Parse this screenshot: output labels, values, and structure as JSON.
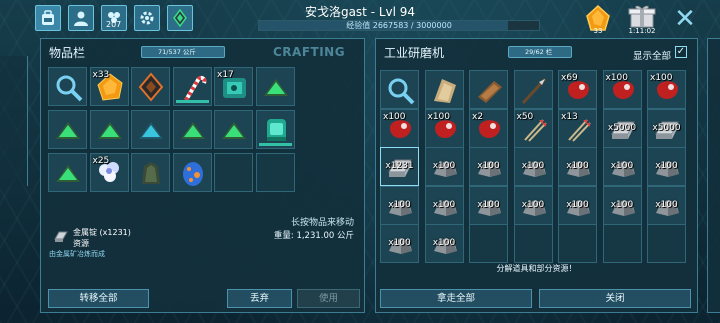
{
  "topbar": {
    "tabs": [
      {
        "icon": "backpack-icon",
        "count": ""
      },
      {
        "icon": "character-icon",
        "count": ""
      },
      {
        "icon": "engrams-icon",
        "count": "207"
      },
      {
        "icon": "tribe-settings-icon",
        "count": ""
      },
      {
        "icon": "element-crystal-icon",
        "count": ""
      }
    ],
    "title": "安戈洛gast - Lvl 94",
    "xp_text": "经验值 2667583 / 3000000",
    "xp_fraction": 0.889,
    "amber_count": "33",
    "gift_timer": "1:11:02",
    "close_glyph": "✕"
  },
  "inventory": {
    "title": "物品栏",
    "weight_pill": "71/537 公斤",
    "crafting_tab": "CRAFTING",
    "slots": [
      {
        "icon": "magnifier-icon",
        "qty": ""
      },
      {
        "icon": "amber-icon",
        "qty": "x33"
      },
      {
        "icon": "implant-icon",
        "qty": ""
      },
      {
        "icon": "candy-cane-icon",
        "qty": ""
      },
      {
        "icon": "cryo-chip-icon",
        "qty": "x17"
      },
      {
        "icon": "green-note-icon",
        "qty": ""
      },
      {
        "icon": "green-note-icon",
        "qty": ""
      },
      {
        "icon": "green-note-icon",
        "qty": ""
      },
      {
        "icon": "blue-note-icon",
        "qty": ""
      },
      {
        "icon": "green-note-icon",
        "qty": ""
      },
      {
        "icon": "green-note-icon",
        "qty": ""
      },
      {
        "icon": "cryo-pod-icon",
        "qty": ""
      },
      {
        "icon": "green-note-icon",
        "qty": ""
      },
      {
        "icon": "white-flower-icon",
        "qty": "x25"
      },
      {
        "icon": "ghillie-armor-icon",
        "qty": ""
      },
      {
        "icon": "blue-egg-icon",
        "qty": ""
      }
    ],
    "hint": "长按物品来移动",
    "weight_line": "重量: 1,231.00 公斤",
    "selected_item": {
      "name": "金属锭 (x1231)",
      "type": "资源",
      "desc": "由金属矿冶炼而成"
    },
    "buttons": {
      "transfer_all": "转移全部",
      "drop": "丢弃",
      "use": "使用"
    }
  },
  "grinder": {
    "title": "工业研磨机",
    "weight_pill": "29/62 栏",
    "show_all_label": "显示全部",
    "show_all_checked": "✓",
    "slots": [
      {
        "icon": "magnifier-icon",
        "qty": ""
      },
      {
        "icon": "fur-armor-icon",
        "qty": ""
      },
      {
        "icon": "wood-club-icon",
        "qty": ""
      },
      {
        "icon": "spear-icon",
        "qty": ""
      },
      {
        "icon": "raw-meat-icon",
        "qty": "x69"
      },
      {
        "icon": "raw-meat-icon",
        "qty": "x100"
      },
      {
        "icon": "raw-meat-icon",
        "qty": "x100"
      },
      {
        "icon": "raw-meat-icon",
        "qty": "x100"
      },
      {
        "icon": "raw-meat-icon",
        "qty": "x100"
      },
      {
        "icon": "raw-meat-icon",
        "qty": "x2"
      },
      {
        "icon": "arrow-bundle-icon",
        "qty": "x50"
      },
      {
        "icon": "arrow-bundle-icon",
        "qty": "x13"
      },
      {
        "icon": "metal-ingot-icon",
        "qty": "x5000"
      },
      {
        "icon": "metal-ingot-icon",
        "qty": "x5000"
      },
      {
        "icon": "metal-ingot-icon",
        "qty": "x1231"
      },
      {
        "icon": "stone-icon",
        "qty": "x100"
      },
      {
        "icon": "stone-icon",
        "qty": "x100"
      },
      {
        "icon": "stone-icon",
        "qty": "x100"
      },
      {
        "icon": "stone-icon",
        "qty": "x100"
      },
      {
        "icon": "stone-icon",
        "qty": "x100"
      },
      {
        "icon": "stone-icon",
        "qty": "x100"
      },
      {
        "icon": "stone-icon",
        "qty": "x100"
      },
      {
        "icon": "stone-icon",
        "qty": "x100"
      },
      {
        "icon": "stone-icon",
        "qty": "x100"
      },
      {
        "icon": "stone-icon",
        "qty": "x100"
      },
      {
        "icon": "stone-icon",
        "qty": "x100"
      },
      {
        "icon": "stone-icon",
        "qty": "x100"
      },
      {
        "icon": "stone-icon",
        "qty": "x100"
      },
      {
        "icon": "stone-icon",
        "qty": "x100"
      },
      {
        "icon": "stone-icon",
        "qty": "x100"
      }
    ],
    "salvage_note": "分解道具和部分资源！",
    "buttons": {
      "take_all": "拿走全部",
      "close": "关闭"
    }
  },
  "colors": {
    "panel_bg": "#12303c",
    "border": "#3d7d94",
    "accent": "#8fdcf5",
    "durability": "#34c0a6"
  }
}
